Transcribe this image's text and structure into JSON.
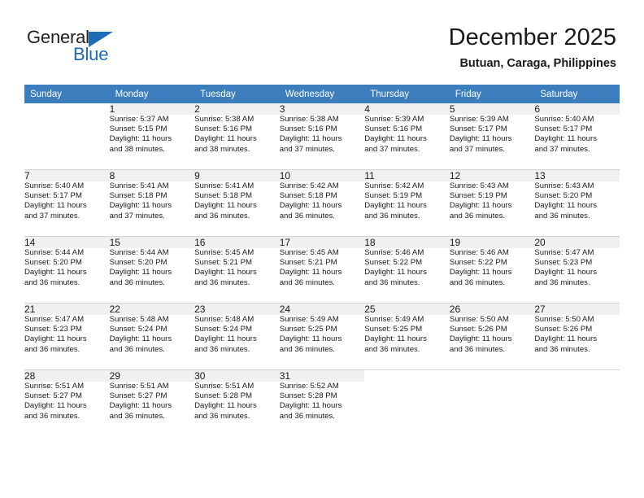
{
  "brand": {
    "name_primary": "General",
    "name_secondary": "Blue",
    "triangle_icon": "triangle-icon",
    "accent_color": "#1d6cb5"
  },
  "header": {
    "title": "December 2025",
    "subtitle": "Butuan, Caraga, Philippines"
  },
  "calendar": {
    "header_color": "#3b7dbd",
    "daynum_bg": "#f0f0f0",
    "weekdays": [
      "Sunday",
      "Monday",
      "Tuesday",
      "Wednesday",
      "Thursday",
      "Friday",
      "Saturday"
    ],
    "weeks": [
      [
        {
          "day": "",
          "sunrise": "",
          "sunset": "",
          "daylight": "",
          "daylight2": ""
        },
        {
          "day": "1",
          "sunrise": "Sunrise: 5:37 AM",
          "sunset": "Sunset: 5:15 PM",
          "daylight": "Daylight: 11 hours",
          "daylight2": "and 38 minutes."
        },
        {
          "day": "2",
          "sunrise": "Sunrise: 5:38 AM",
          "sunset": "Sunset: 5:16 PM",
          "daylight": "Daylight: 11 hours",
          "daylight2": "and 38 minutes."
        },
        {
          "day": "3",
          "sunrise": "Sunrise: 5:38 AM",
          "sunset": "Sunset: 5:16 PM",
          "daylight": "Daylight: 11 hours",
          "daylight2": "and 37 minutes."
        },
        {
          "day": "4",
          "sunrise": "Sunrise: 5:39 AM",
          "sunset": "Sunset: 5:16 PM",
          "daylight": "Daylight: 11 hours",
          "daylight2": "and 37 minutes."
        },
        {
          "day": "5",
          "sunrise": "Sunrise: 5:39 AM",
          "sunset": "Sunset: 5:17 PM",
          "daylight": "Daylight: 11 hours",
          "daylight2": "and 37 minutes."
        },
        {
          "day": "6",
          "sunrise": "Sunrise: 5:40 AM",
          "sunset": "Sunset: 5:17 PM",
          "daylight": "Daylight: 11 hours",
          "daylight2": "and 37 minutes."
        }
      ],
      [
        {
          "day": "7",
          "sunrise": "Sunrise: 5:40 AM",
          "sunset": "Sunset: 5:17 PM",
          "daylight": "Daylight: 11 hours",
          "daylight2": "and 37 minutes."
        },
        {
          "day": "8",
          "sunrise": "Sunrise: 5:41 AM",
          "sunset": "Sunset: 5:18 PM",
          "daylight": "Daylight: 11 hours",
          "daylight2": "and 37 minutes."
        },
        {
          "day": "9",
          "sunrise": "Sunrise: 5:41 AM",
          "sunset": "Sunset: 5:18 PM",
          "daylight": "Daylight: 11 hours",
          "daylight2": "and 36 minutes."
        },
        {
          "day": "10",
          "sunrise": "Sunrise: 5:42 AM",
          "sunset": "Sunset: 5:18 PM",
          "daylight": "Daylight: 11 hours",
          "daylight2": "and 36 minutes."
        },
        {
          "day": "11",
          "sunrise": "Sunrise: 5:42 AM",
          "sunset": "Sunset: 5:19 PM",
          "daylight": "Daylight: 11 hours",
          "daylight2": "and 36 minutes."
        },
        {
          "day": "12",
          "sunrise": "Sunrise: 5:43 AM",
          "sunset": "Sunset: 5:19 PM",
          "daylight": "Daylight: 11 hours",
          "daylight2": "and 36 minutes."
        },
        {
          "day": "13",
          "sunrise": "Sunrise: 5:43 AM",
          "sunset": "Sunset: 5:20 PM",
          "daylight": "Daylight: 11 hours",
          "daylight2": "and 36 minutes."
        }
      ],
      [
        {
          "day": "14",
          "sunrise": "Sunrise: 5:44 AM",
          "sunset": "Sunset: 5:20 PM",
          "daylight": "Daylight: 11 hours",
          "daylight2": "and 36 minutes."
        },
        {
          "day": "15",
          "sunrise": "Sunrise: 5:44 AM",
          "sunset": "Sunset: 5:20 PM",
          "daylight": "Daylight: 11 hours",
          "daylight2": "and 36 minutes."
        },
        {
          "day": "16",
          "sunrise": "Sunrise: 5:45 AM",
          "sunset": "Sunset: 5:21 PM",
          "daylight": "Daylight: 11 hours",
          "daylight2": "and 36 minutes."
        },
        {
          "day": "17",
          "sunrise": "Sunrise: 5:45 AM",
          "sunset": "Sunset: 5:21 PM",
          "daylight": "Daylight: 11 hours",
          "daylight2": "and 36 minutes."
        },
        {
          "day": "18",
          "sunrise": "Sunrise: 5:46 AM",
          "sunset": "Sunset: 5:22 PM",
          "daylight": "Daylight: 11 hours",
          "daylight2": "and 36 minutes."
        },
        {
          "day": "19",
          "sunrise": "Sunrise: 5:46 AM",
          "sunset": "Sunset: 5:22 PM",
          "daylight": "Daylight: 11 hours",
          "daylight2": "and 36 minutes."
        },
        {
          "day": "20",
          "sunrise": "Sunrise: 5:47 AM",
          "sunset": "Sunset: 5:23 PM",
          "daylight": "Daylight: 11 hours",
          "daylight2": "and 36 minutes."
        }
      ],
      [
        {
          "day": "21",
          "sunrise": "Sunrise: 5:47 AM",
          "sunset": "Sunset: 5:23 PM",
          "daylight": "Daylight: 11 hours",
          "daylight2": "and 36 minutes."
        },
        {
          "day": "22",
          "sunrise": "Sunrise: 5:48 AM",
          "sunset": "Sunset: 5:24 PM",
          "daylight": "Daylight: 11 hours",
          "daylight2": "and 36 minutes."
        },
        {
          "day": "23",
          "sunrise": "Sunrise: 5:48 AM",
          "sunset": "Sunset: 5:24 PM",
          "daylight": "Daylight: 11 hours",
          "daylight2": "and 36 minutes."
        },
        {
          "day": "24",
          "sunrise": "Sunrise: 5:49 AM",
          "sunset": "Sunset: 5:25 PM",
          "daylight": "Daylight: 11 hours",
          "daylight2": "and 36 minutes."
        },
        {
          "day": "25",
          "sunrise": "Sunrise: 5:49 AM",
          "sunset": "Sunset: 5:25 PM",
          "daylight": "Daylight: 11 hours",
          "daylight2": "and 36 minutes."
        },
        {
          "day": "26",
          "sunrise": "Sunrise: 5:50 AM",
          "sunset": "Sunset: 5:26 PM",
          "daylight": "Daylight: 11 hours",
          "daylight2": "and 36 minutes."
        },
        {
          "day": "27",
          "sunrise": "Sunrise: 5:50 AM",
          "sunset": "Sunset: 5:26 PM",
          "daylight": "Daylight: 11 hours",
          "daylight2": "and 36 minutes."
        }
      ],
      [
        {
          "day": "28",
          "sunrise": "Sunrise: 5:51 AM",
          "sunset": "Sunset: 5:27 PM",
          "daylight": "Daylight: 11 hours",
          "daylight2": "and 36 minutes."
        },
        {
          "day": "29",
          "sunrise": "Sunrise: 5:51 AM",
          "sunset": "Sunset: 5:27 PM",
          "daylight": "Daylight: 11 hours",
          "daylight2": "and 36 minutes."
        },
        {
          "day": "30",
          "sunrise": "Sunrise: 5:51 AM",
          "sunset": "Sunset: 5:28 PM",
          "daylight": "Daylight: 11 hours",
          "daylight2": "and 36 minutes."
        },
        {
          "day": "31",
          "sunrise": "Sunrise: 5:52 AM",
          "sunset": "Sunset: 5:28 PM",
          "daylight": "Daylight: 11 hours",
          "daylight2": "and 36 minutes."
        },
        {
          "day": "",
          "sunrise": "",
          "sunset": "",
          "daylight": "",
          "daylight2": ""
        },
        {
          "day": "",
          "sunrise": "",
          "sunset": "",
          "daylight": "",
          "daylight2": ""
        },
        {
          "day": "",
          "sunrise": "",
          "sunset": "",
          "daylight": "",
          "daylight2": ""
        }
      ]
    ]
  }
}
